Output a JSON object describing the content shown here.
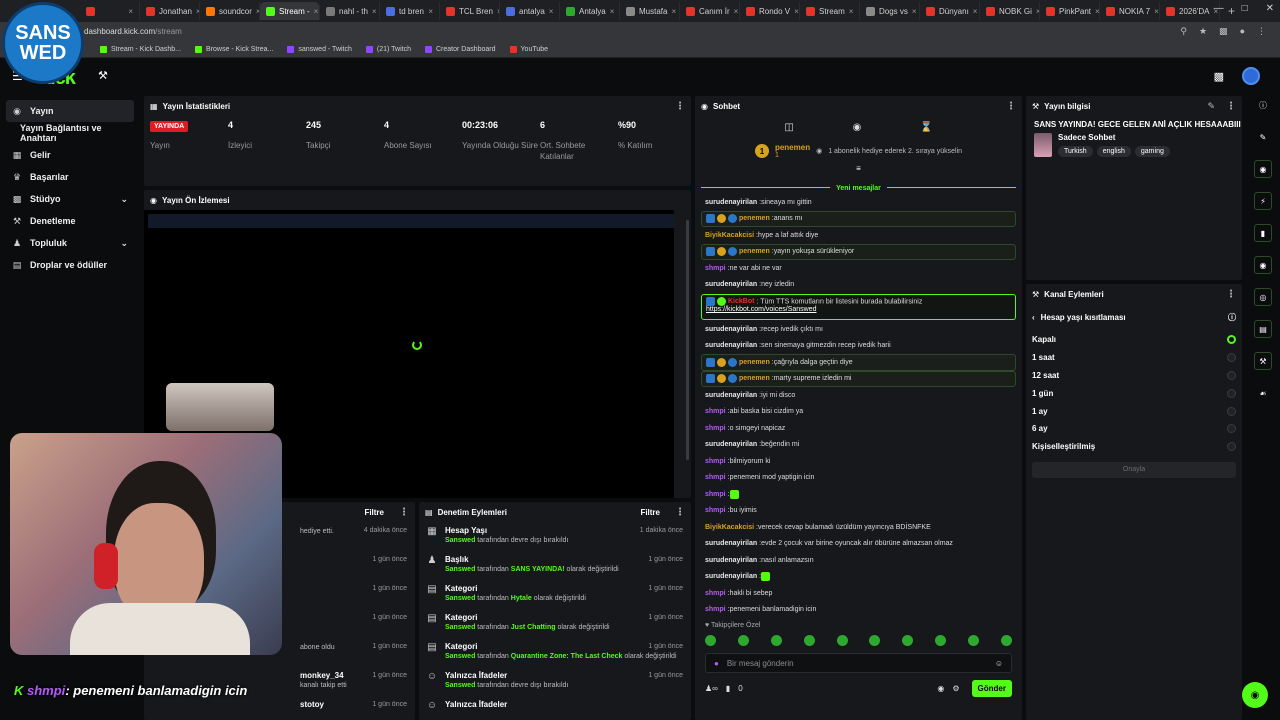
{
  "browser": {
    "tabs": [
      {
        "label": "",
        "color": "#e6332a"
      },
      {
        "label": "Jonathan",
        "color": "#e6332a"
      },
      {
        "label": "soundcor",
        "color": "#ff7700"
      },
      {
        "label": "Stream -",
        "color": "#53fc18"
      },
      {
        "label": "nahl - th",
        "color": "#7a7a7a"
      },
      {
        "label": "td bren",
        "color": "#4a6ee0"
      },
      {
        "label": "TCL Bren",
        "color": "#e6332a"
      },
      {
        "label": "antalya",
        "color": "#4a6ee0"
      },
      {
        "label": "Antalya",
        "color": "#2ea82e"
      },
      {
        "label": "Mustafa",
        "color": "#8a8a8a"
      },
      {
        "label": "Canım İr",
        "color": "#e6332a"
      },
      {
        "label": "Rondo V",
        "color": "#e6332a"
      },
      {
        "label": "Stream",
        "color": "#e6332a"
      },
      {
        "label": "Dogs vs",
        "color": "#8a8a8a"
      },
      {
        "label": "Dünyanı",
        "color": "#e6332a"
      },
      {
        "label": "NOBK Gi",
        "color": "#e6332a"
      },
      {
        "label": "PinkPant",
        "color": "#e6332a"
      },
      {
        "label": "NOKIA 7",
        "color": "#e6332a"
      },
      {
        "label": "2026'DA",
        "color": "#e6332a"
      }
    ],
    "active_tab": 3,
    "url_host": "dashboard.kick.com",
    "url_path": "/stream",
    "bookmarks": [
      {
        "label": "Stream - Kick Dashb...",
        "color": "#53fc18"
      },
      {
        "label": "Browse - Kick Strea...",
        "color": "#53fc18"
      },
      {
        "label": "sanswed - Twitch",
        "color": "#9146ff"
      },
      {
        "label": "(21) Twitch",
        "color": "#9146ff"
      },
      {
        "label": "Creator Dashboard",
        "color": "#9146ff"
      },
      {
        "label": "YouTube",
        "color": "#e6332a"
      }
    ]
  },
  "overlay": {
    "logo_line1": "SANS",
    "logo_line2": "WED",
    "chat_user": "shmpi",
    "chat_text": ": penemeni banlamadigin icin"
  },
  "kick": {
    "logo": "kick"
  },
  "sidebar": {
    "items": [
      {
        "label": "Yayın",
        "icon": "broadcast-icon"
      },
      {
        "label": "Yayın Bağlantısı ve Anahtarı"
      },
      {
        "label": "Gelir",
        "icon": "money-icon"
      },
      {
        "label": "Başarılar",
        "icon": "trophy-icon"
      },
      {
        "label": "Stüdyo",
        "icon": "studio-icon"
      },
      {
        "label": "Denetleme",
        "icon": "wrench-icon"
      },
      {
        "label": "Topluluk",
        "icon": "people-icon"
      },
      {
        "label": "Droplar ve ödüller",
        "icon": "gift-icon"
      }
    ]
  },
  "stats": {
    "title": "Yayın İstatistikleri",
    "live_badge": "YAYINDA",
    "live_label": "Yayın",
    "items": [
      {
        "value": "4",
        "label": "İzleyici"
      },
      {
        "value": "245",
        "label": "Takipçi"
      },
      {
        "value": "4",
        "label": "Abone Sayısı"
      },
      {
        "value": "00:23:06",
        "label": "Yayında Olduğu Süre"
      },
      {
        "value": "6",
        "label": "Ort. Sohbete Katılanlar"
      },
      {
        "value": "%90",
        "label": "% Katılım"
      }
    ]
  },
  "preview": {
    "title": "Yayın Ön İzlemesi"
  },
  "activity": {
    "filter": "Filtre",
    "rows": [
      {
        "time": "4 dakika önce",
        "desc": "hediye etti."
      },
      {
        "time": "1 gün önce",
        "desc": ""
      },
      {
        "time": "1 gün önce",
        "desc": ""
      },
      {
        "time": "1 gün önce",
        "desc": ""
      },
      {
        "time": "1 gün önce",
        "desc": "abone oldu"
      },
      {
        "time": "1 gün önce",
        "title": "monkey_34",
        "desc": "kanalı takip etti"
      },
      {
        "time": "1 gün önce",
        "title": "stotoy",
        "desc": ""
      }
    ]
  },
  "moderation": {
    "title": "Denetim Eylemleri",
    "filter": "Filtre",
    "rows": [
      {
        "title": "Hesap Yaşı",
        "user": "Sanswed",
        "mid": " tarafından devre dışı bırakıldı",
        "hl": "",
        "tail": "",
        "time": "1 dakika önce",
        "icon": "calendar-icon"
      },
      {
        "title": "Başlık",
        "user": "Sanswed",
        "mid": " tarafından ",
        "hl": "SANS YAYINDA!",
        "tail": " olarak değiştirildi",
        "time": "1 gün önce",
        "icon": "title-icon"
      },
      {
        "title": "Kategori",
        "user": "Sanswed",
        "mid": " tarafından ",
        "hl": "Hytale",
        "tail": " olarak değiştirildi",
        "time": "1 gün önce",
        "icon": "category-icon"
      },
      {
        "title": "Kategori",
        "user": "Sanswed",
        "mid": " tarafından ",
        "hl": "Just Chatting",
        "tail": " olarak değiştirildi",
        "time": "1 gün önce",
        "icon": "category-icon"
      },
      {
        "title": "Kategori",
        "user": "Sanswed",
        "mid": " tarafından ",
        "hl": "Quarantine Zone: The Last Check",
        "tail": " olarak değiştirildi",
        "time": "1 gün önce",
        "icon": "category-icon"
      },
      {
        "title": "Yalnızca İfadeler",
        "user": "Sanswed",
        "mid": " tarafından devre dışı bırakıldı",
        "hl": "",
        "tail": "",
        "time": "1 gün önce",
        "icon": "emote-icon"
      },
      {
        "title": "Yalnızca İfadeler",
        "user": "",
        "mid": "",
        "hl": "",
        "tail": "",
        "time": "",
        "icon": "emote-icon"
      }
    ]
  },
  "chat": {
    "title": "Sohbet",
    "pinned_user": "penemen",
    "pinned_badge": "1",
    "pinned_count": "1",
    "pinned_text": "1 abonelik hediye ederek 2. sıraya yükselin",
    "new_messages": "Yeni mesajlar",
    "messages": [
      {
        "user": "surudenayirilan",
        "color": "#e8e8e8",
        "text": "sineaya mı gittin",
        "type": ""
      },
      {
        "user": "penemen",
        "color": "#d7a21c",
        "text": "anans mı",
        "type": "hl"
      },
      {
        "user": "BiyikKacakcisi",
        "color": "#d7a21c",
        "text": "hype a laf attık diye",
        "type": ""
      },
      {
        "user": "penemen",
        "color": "#d7a21c",
        "text": "yayın yokuşa sürükleniyor",
        "type": "hl"
      },
      {
        "user": "shmpi",
        "color": "#b45cf7",
        "text": "ne var abi ne var",
        "type": ""
      },
      {
        "user": "surudenayirilan",
        "color": "#e8e8e8",
        "text": "ney izledin",
        "type": ""
      },
      {
        "user": "KickBot",
        "color": "#e6332a",
        "text": "Tüm TTS komutların bir listesini burada bulabilirsiniz",
        "link": "https://kickbot.com/voices/Sanswed",
        "type": "bot"
      },
      {
        "user": "surudenayirilan",
        "color": "#e8e8e8",
        "text": "recep ivedik çıktı mı",
        "type": ""
      },
      {
        "user": "surudenayirilan",
        "color": "#e8e8e8",
        "text": "sen sinemaya gitmezdin recep ivedik harii",
        "type": ""
      },
      {
        "user": "penemen",
        "color": "#d7a21c",
        "text": "çağrıyla dalga geçtin diye",
        "type": "hl"
      },
      {
        "user": "penemen",
        "color": "#d7a21c",
        "text": "marty supreme izledin mi",
        "type": "hl"
      },
      {
        "user": "surudenayirilan",
        "color": "#e8e8e8",
        "text": "iyi mi disco",
        "type": ""
      },
      {
        "user": "shmpi",
        "color": "#b45cf7",
        "text": "abi baska bisi cizdim ya",
        "type": ""
      },
      {
        "user": "shmpi",
        "color": "#b45cf7",
        "text": "o simgeyi napicaz",
        "type": ""
      },
      {
        "user": "surudenayirilan",
        "color": "#e8e8e8",
        "text": "beğendin mi",
        "type": ""
      },
      {
        "user": "shmpi",
        "color": "#b45cf7",
        "text": "bilmiyorum ki",
        "type": ""
      },
      {
        "user": "shmpi",
        "color": "#b45cf7",
        "text": "penemeni mod yaptigin icin",
        "type": ""
      },
      {
        "user": "shmpi",
        "color": "#b45cf7",
        "text": "",
        "type": "emote"
      },
      {
        "user": "shmpi",
        "color": "#b45cf7",
        "text": "bu iyimis",
        "type": ""
      },
      {
        "user": "BiyikKacakcisi",
        "color": "#d7a21c",
        "text": "verecek cevap bulamadı üzüldüm yayıncıya BDİSNFKE",
        "type": ""
      },
      {
        "user": "surudenayirilan",
        "color": "#e8e8e8",
        "text": "evde 2 çocuk var birine oyuncak alır öbürüne almazsan olmaz",
        "type": ""
      },
      {
        "user": "surudenayirilan",
        "color": "#e8e8e8",
        "text": "nasıl anlamazsın",
        "type": ""
      },
      {
        "user": "surudenayirilan",
        "color": "#e8e8e8",
        "text": "",
        "type": "emote"
      },
      {
        "user": "shmpi",
        "color": "#b45cf7",
        "text": "hakli bi sebep",
        "type": ""
      },
      {
        "user": "shmpi",
        "color": "#b45cf7",
        "text": "penemeni banlamadigin icin",
        "type": ""
      }
    ],
    "follower_note": "Takipçilere Özel",
    "input_placeholder": "Bir mesaj gönderin",
    "viewer_count": "0",
    "send_label": "Gönder"
  },
  "stream_info": {
    "title": "Yayın bilgisi",
    "stream_title": "SANS YAYINDA! GECE GELEN ANİ AÇLIK HESAAABIII",
    "category": "Sadece Sohbet",
    "tags": [
      "Turkish",
      "english",
      "gaming"
    ]
  },
  "channel_actions": {
    "title": "Kanal Eylemleri",
    "sub_title": "Hesap yaşı kısıtlaması",
    "options": [
      "Kapalı",
      "1 saat",
      "12 saat",
      "1 gün",
      "1 ay",
      "6 ay",
      "Kişiselleştirilmiş"
    ],
    "selected": "Kapalı",
    "approve": "Onayla"
  },
  "colors": {
    "accent": "#53fc18",
    "live": "#e01b24",
    "panel": "#17181b",
    "bg": "#0b0c0e"
  }
}
